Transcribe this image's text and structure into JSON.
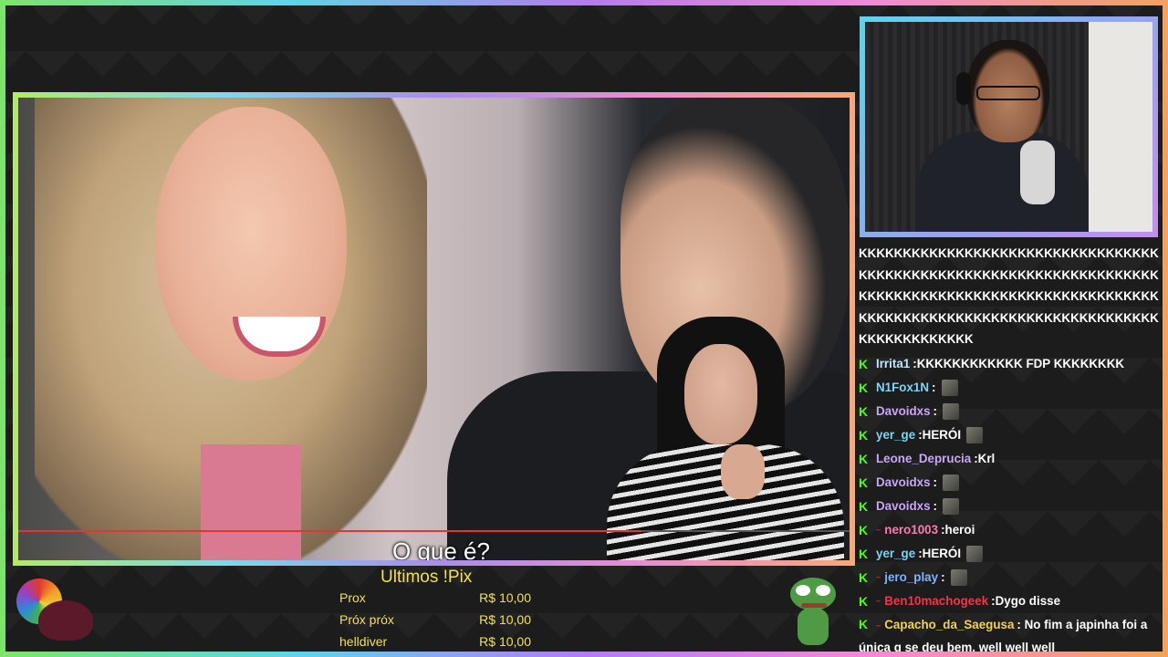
{
  "video": {
    "subtitle": "O que é?",
    "progress_percent": 75
  },
  "chat": {
    "spam": "KKKKKKKKKKKKKKKKKKKKKKKKKKKKKKKKKKKKKKKKKKKKKKKKKKKKKKKKKKKKKKKKKKKKKKKKKKKKKKKKKKKKKKKKKKKKKKKKKKKKKKKKKKKKKKKKKKKKKKKKKKKKKKKKKKKKKKKKKKKKKKKKKKKKK",
    "messages": [
      {
        "user": "Irrita1",
        "color": "#bde6ff",
        "text": "KKKKKKKKKKKK FDP KKKKKKKK",
        "emote": false,
        "sub_badge": false
      },
      {
        "user": "N1Fox1N",
        "color": "#7bd5f2",
        "text": "",
        "emote": true,
        "sub_badge": false
      },
      {
        "user": "Davoidxs",
        "color": "#c8a5f5",
        "text": "",
        "emote": true,
        "sub_badge": false
      },
      {
        "user": "yer_ge",
        "color": "#7bd5f2",
        "text": "HERÓI",
        "emote": true,
        "sub_badge": false
      },
      {
        "user": "Leone_Deprucia",
        "color": "#c8a5f5",
        "text": "Krl",
        "emote": false,
        "sub_badge": false
      },
      {
        "user": "Davoidxs",
        "color": "#c8a5f5",
        "text": "",
        "emote": true,
        "sub_badge": false
      },
      {
        "user": "Davoidxs",
        "color": "#c8a5f5",
        "text": "",
        "emote": true,
        "sub_badge": false
      },
      {
        "user": "nero1003",
        "color": "#f47fb0",
        "text": "heroi",
        "emote": false,
        "sub_badge": true
      },
      {
        "user": "yer_ge",
        "color": "#7bd5f2",
        "text": "HERÓI",
        "emote": true,
        "sub_badge": false
      },
      {
        "user": "jero_play",
        "color": "#7fb2ff",
        "text": "",
        "emote": true,
        "sub_badge": true
      },
      {
        "user": "Ben10machogeek",
        "color": "#f0364a",
        "text": "Dygo disse",
        "emote": false,
        "sub_badge": true
      },
      {
        "user": "Capacho_da_Saegusa",
        "color": "#f2d15a",
        "text": "No fim a japinha foi a única q se deu bem, well well well",
        "emote": false,
        "sub_badge": true
      }
    ]
  },
  "pix": {
    "title": "Ultimos !Pix",
    "entries": [
      {
        "name": "Prox",
        "amount": "R$ 10,00"
      },
      {
        "name": "Próx próx",
        "amount": "R$ 10,00"
      },
      {
        "name": "helldiver",
        "amount": "R$ 10,00"
      }
    ]
  },
  "colors": {
    "pix_text": "#f4e04d",
    "kick_badge": "#53fc18",
    "progress": "#e8323a"
  }
}
